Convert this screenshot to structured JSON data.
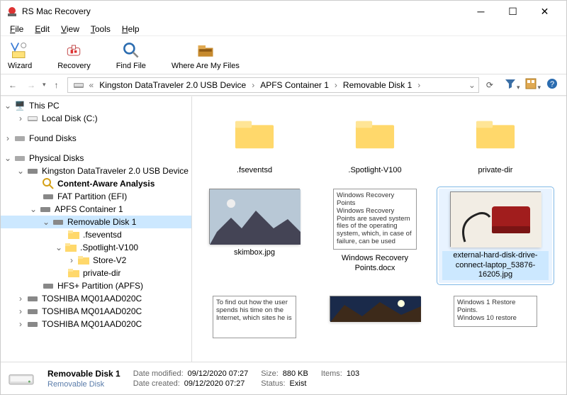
{
  "title": "RS Mac Recovery",
  "menu": {
    "file": "File",
    "edit": "Edit",
    "view": "View",
    "tools": "Tools",
    "help": "Help"
  },
  "tools": {
    "wizard": "Wizard",
    "recovery": "Recovery",
    "find": "Find File",
    "where": "Where Are My Files"
  },
  "breadcrumb": {
    "seg1": "Kingston DataTraveler 2.0 USB Device",
    "seg2": "APFS Container 1",
    "seg3": "Removable Disk 1"
  },
  "tree": {
    "this_pc": "This PC",
    "local_disk": "Local Disk (C:)",
    "found": "Found Disks",
    "physical": "Physical Disks",
    "kingston": "Kingston DataTraveler 2.0 USB Device",
    "caa": "Content-Aware Analysis",
    "fat": "FAT Partition (EFI)",
    "apfs": "APFS Container 1",
    "removable": "Removable Disk 1",
    "fsev": ".fseventsd",
    "spot": ".Spotlight-V100",
    "store": "Store-V2",
    "private": "private-dir",
    "hfs": "HFS+ Partition (APFS)",
    "tosh1": "TOSHIBA MQ01AAD020C",
    "tosh2": "TOSHIBA MQ01AAD020C",
    "tosh3": "TOSHIBA MQ01AAD020C"
  },
  "items": {
    "folder1": ".fseventsd",
    "folder2": ".Spotlight-V100",
    "folder3": "private-dir",
    "img1": "skimbox.jpg",
    "doc1": "Windows Recovery Points.docx",
    "doc1_preview": "Windows Recovery Points\nWindows Recovery Points are saved system files of the operating system, which, in case of failure, can be used",
    "img2": "external-hard-disk-drive-connect-laptop_53876-16205.jpg",
    "doc2_preview": "To find out how the user spends his time on the Internet, which sites he is",
    "doc3_preview": "Windows 1 Restore Points.\nWindows 10 restore"
  },
  "status": {
    "name": "Removable Disk 1",
    "type": "Removable Disk",
    "mod_label": "Date modified:",
    "mod_val": "09/12/2020 07:27",
    "cre_label": "Date created:",
    "cre_val": "09/12/2020 07:27",
    "size_label": "Size:",
    "size_val": "880 KB",
    "items_label": "Items:",
    "items_val": "103",
    "stat_label": "Status:",
    "stat_val": "Exist"
  }
}
